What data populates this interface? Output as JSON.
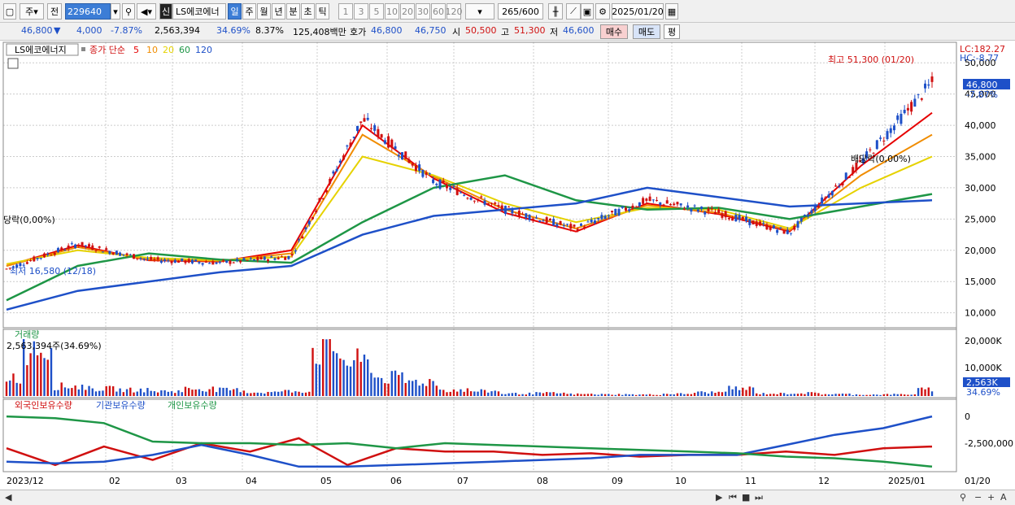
{
  "toolbar": {
    "period_select": "주",
    "prev_label": "전",
    "code_input": "229640",
    "shin_label": "신",
    "stock_name": "LS에코에너",
    "tabs": [
      "일",
      "주",
      "월",
      "년",
      "분",
      "초",
      "틱"
    ],
    "active_tab": "일",
    "intervals": [
      "1",
      "3",
      "5",
      "10",
      "20",
      "30",
      "60",
      "120"
    ],
    "count": "265",
    "count_total": "/600",
    "date": "2025/01/20"
  },
  "quote": {
    "price": "46,800",
    "change": "4,000",
    "change_pct": "-7.87%",
    "volume": "2,563,394",
    "turnover_pct": "34.69%",
    "amp_pct": "8.37%",
    "amount": "125,408백만",
    "hoga_label": "호가",
    "ask": "46,800",
    "bid": "46,750",
    "open_label": "시",
    "open": "50,500",
    "high_label": "고",
    "high": "51,300",
    "low_label": "저",
    "low": "46,600",
    "buy_label": "매수",
    "sell_label": "매도",
    "eval_label": "평"
  },
  "legend": {
    "name": "LS에코에너지",
    "close_label": "종가 단순",
    "ma": [
      {
        "label": "5",
        "color": "#e60000"
      },
      {
        "label": "10",
        "color": "#f08c00"
      },
      {
        "label": "20",
        "color": "#e6d200"
      },
      {
        "label": "60",
        "color": "#1e9646"
      },
      {
        "label": "120",
        "color": "#1e50c8"
      }
    ]
  },
  "annotations": {
    "high": "최고 51,300 (01/20)",
    "low": "최저 16,580 (12/18)",
    "div1": "당락(0,00%)",
    "div2": "배당락(0,00%)",
    "lc": "LC:182.27",
    "hc": "HC:-8.77",
    "cur_price": "46,800",
    "cur_pct": "-7.87%"
  },
  "volume_panel": {
    "title": "거래량",
    "value": "2,563,394주(34.69%)",
    "axis": [
      "20,000K",
      "10,000K"
    ],
    "cur": "2,563K",
    "cur_pct": "34.69%"
  },
  "holdings_panel": {
    "legend": [
      {
        "label": "외국인보유수량",
        "color": "#d01010"
      },
      {
        "label": "기관보유수량",
        "color": "#1e50c8"
      },
      {
        "label": "개인보유수량",
        "color": "#1e9646"
      }
    ],
    "axis": [
      "0",
      "-2,500,000"
    ]
  },
  "x_axis": [
    "2023/12",
    "02",
    "03",
    "04",
    "05",
    "06",
    "07",
    "08",
    "09",
    "10",
    "11",
    "12",
    "2025/01",
    "01/20"
  ],
  "chart_data": {
    "type": "line",
    "title": "LS에코에너지",
    "y_ticks": [
      10000,
      15000,
      20000,
      25000,
      30000,
      35000,
      40000,
      45000,
      50000
    ],
    "ylim": [
      8000,
      52500
    ],
    "price": {
      "name": "종가",
      "x": [
        "2023/12",
        "02",
        "03",
        "04",
        "05",
        "06",
        "07",
        "08",
        "09",
        "10",
        "11",
        "12",
        "2025/01",
        "01/20"
      ],
      "values": [
        17000,
        21000,
        18500,
        18000,
        19000,
        41000,
        31000,
        26500,
        23500,
        28000,
        26000,
        22800,
        34000,
        46800
      ]
    },
    "series": [
      {
        "name": "5",
        "values": [
          17500,
          20800,
          18400,
          18200,
          20000,
          40000,
          31500,
          26000,
          23000,
          27500,
          25800,
          23000,
          33500,
          42000
        ]
      },
      {
        "name": "10",
        "values": [
          17500,
          20500,
          18500,
          18300,
          19500,
          38500,
          31800,
          26500,
          23500,
          27200,
          26000,
          23200,
          32000,
          38500
        ]
      },
      {
        "name": "20",
        "values": [
          17800,
          20000,
          18800,
          18400,
          19000,
          35000,
          32000,
          27500,
          24500,
          26800,
          26500,
          23500,
          30000,
          35000
        ]
      },
      {
        "name": "60",
        "values": [
          12000,
          17500,
          19500,
          18500,
          18000,
          24500,
          30000,
          32000,
          28000,
          26500,
          26800,
          25000,
          27000,
          29000
        ]
      },
      {
        "name": "120",
        "values": [
          10500,
          13500,
          15000,
          16500,
          17500,
          22500,
          25500,
          26500,
          27500,
          30000,
          28500,
          27000,
          27500,
          28000
        ]
      }
    ],
    "volume": {
      "max": 20000000,
      "values": [
        8000,
        21000,
        4000,
        3000,
        2500,
        2000,
        3000,
        2500,
        1500,
        2000,
        19000,
        14000,
        7500,
        6000,
        2500,
        2000,
        1000,
        1200,
        800,
        700,
        600,
        900,
        1500,
        3000,
        1000,
        1200,
        800,
        600,
        700,
        2563
      ]
    },
    "holdings": {
      "ylim": [
        -3200000,
        300000
      ],
      "series": [
        {
          "name": "외국인보유수량",
          "values": [
            -1800000,
            -2800000,
            -1700000,
            -2500000,
            -1500000,
            -2000000,
            -1200000,
            -2800000,
            -1800000,
            -2000000,
            -2000000,
            -2200000,
            -2100000,
            -2300000,
            -2200000,
            -2200000,
            -2000000,
            -2200000,
            -1800000,
            -1700000
          ]
        },
        {
          "name": "기관보유수량",
          "values": [
            -2600000,
            -2700000,
            -2600000,
            -2200000,
            -1600000,
            -2200000,
            -2900000,
            -2900000,
            -2800000,
            -2700000,
            -2600000,
            -2500000,
            -2400000,
            -2200000,
            -2200000,
            -2200000,
            -1600000,
            -1000000,
            -600000,
            100000
          ]
        },
        {
          "name": "개인보유수량",
          "values": [
            100000,
            0,
            -300000,
            -1400000,
            -1500000,
            -1500000,
            -1600000,
            -1500000,
            -1800000,
            -1500000,
            -1600000,
            -1700000,
            -1800000,
            -1900000,
            -2000000,
            -2100000,
            -2300000,
            -2400000,
            -2600000,
            -2900000
          ]
        }
      ]
    }
  }
}
